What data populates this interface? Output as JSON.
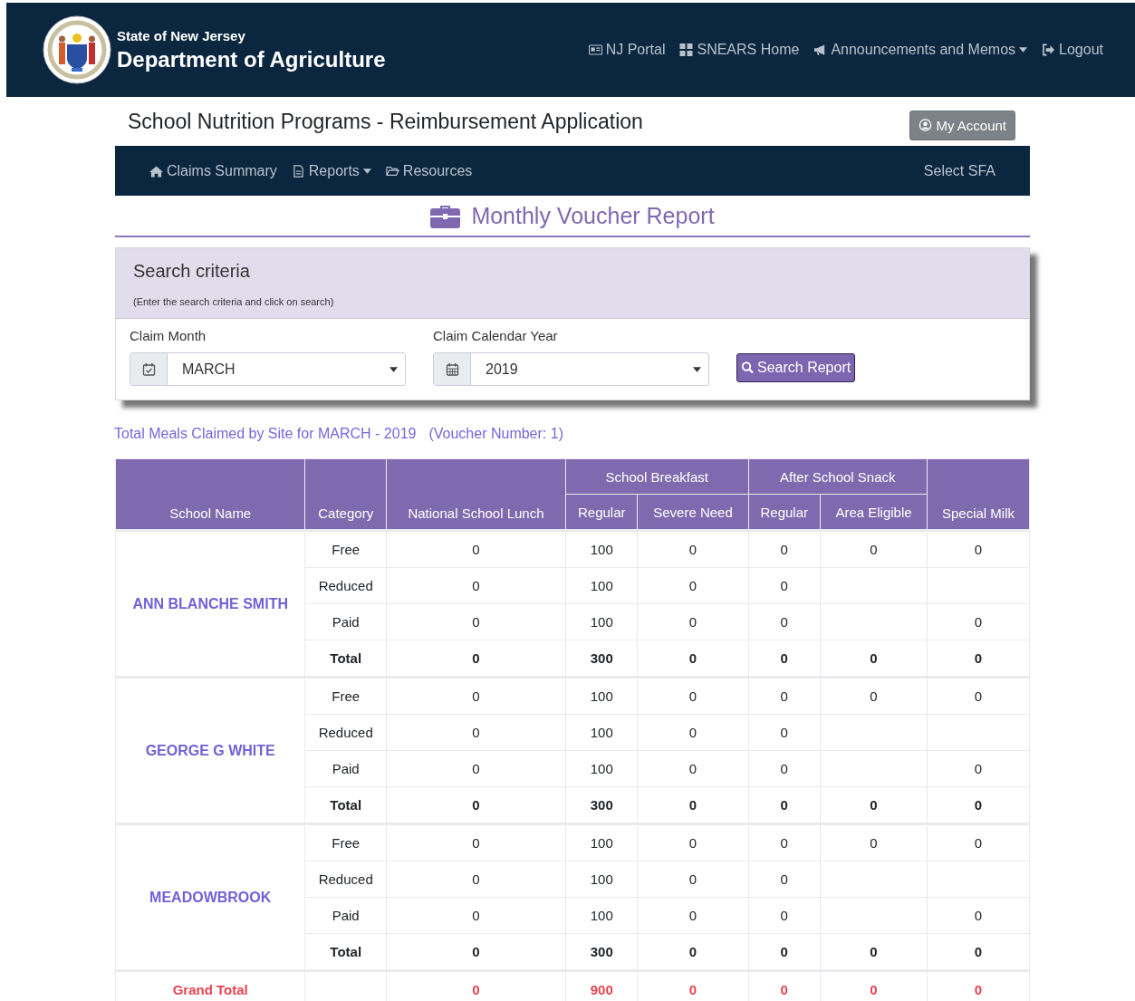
{
  "header": {
    "state": "State of New Jersey",
    "department": "Department of Agriculture",
    "links": [
      {
        "label": "NJ Portal",
        "dropdown": false
      },
      {
        "label": "SNEARS Home",
        "dropdown": false
      },
      {
        "label": "Announcements and Memos",
        "dropdown": true
      },
      {
        "label": "Logout",
        "dropdown": false
      }
    ]
  },
  "app_title": "School Nutrition Programs - Reimbursement Application",
  "account_button": "My Account",
  "nav": {
    "items": [
      {
        "label": "Claims Summary",
        "dropdown": false
      },
      {
        "label": "Reports",
        "dropdown": true
      },
      {
        "label": "Resources",
        "dropdown": false
      }
    ],
    "right_item": "Select SFA"
  },
  "page_title": "Monthly Voucher Report",
  "search": {
    "title": "Search criteria",
    "hint": "(Enter the search criteria and click on search)",
    "fields": [
      {
        "label": "Claim Month",
        "value": "MARCH"
      },
      {
        "label": "Claim Calendar Year",
        "value": "2019"
      }
    ],
    "button": "Search Report"
  },
  "summary": {
    "title": "Total Meals Claimed by Site for MARCH - 2019",
    "voucher": "(Voucher Number: 1)"
  },
  "table": {
    "columns": [
      {
        "label": "School Name"
      },
      {
        "label": "Category"
      },
      {
        "label": "National School Lunch"
      },
      {
        "group": "School Breakfast",
        "subcolumns": [
          "Regular",
          "Severe Need"
        ]
      },
      {
        "group": "After School Snack",
        "subcolumns": [
          "Regular",
          "Area Eligible"
        ]
      },
      {
        "label": "Special Milk"
      }
    ],
    "schools": [
      {
        "name": "ANN BLANCHE SMITH",
        "rows": [
          {
            "kind": "item",
            "category": "Free",
            "lunch": "0",
            "breakfast_regular": "100",
            "breakfast_severe": "0",
            "snack_regular": "0",
            "snack_area": "0",
            "milk": "0"
          },
          {
            "kind": "item",
            "category": "Reduced",
            "lunch": "0",
            "breakfast_regular": "100",
            "breakfast_severe": "0",
            "snack_regular": "0"
          },
          {
            "kind": "item",
            "category": "Paid",
            "lunch": "0",
            "breakfast_regular": "100",
            "breakfast_severe": "0",
            "snack_regular": "0",
            "milk": "0"
          },
          {
            "kind": "total",
            "category": "Total",
            "lunch": "0",
            "breakfast_regular": "300",
            "breakfast_severe": "0",
            "snack_regular": "0",
            "snack_area": "0",
            "milk": "0"
          }
        ]
      },
      {
        "name": "GEORGE G WHITE",
        "rows": [
          {
            "kind": "item",
            "category": "Free",
            "lunch": "0",
            "breakfast_regular": "100",
            "breakfast_severe": "0",
            "snack_regular": "0",
            "snack_area": "0",
            "milk": "0"
          },
          {
            "kind": "item",
            "category": "Reduced",
            "lunch": "0",
            "breakfast_regular": "100",
            "breakfast_severe": "0",
            "snack_regular": "0"
          },
          {
            "kind": "item",
            "category": "Paid",
            "lunch": "0",
            "breakfast_regular": "100",
            "breakfast_severe": "0",
            "snack_regular": "0",
            "milk": "0"
          },
          {
            "kind": "total",
            "category": "Total",
            "lunch": "0",
            "breakfast_regular": "300",
            "breakfast_severe": "0",
            "snack_regular": "0",
            "snack_area": "0",
            "milk": "0"
          }
        ]
      },
      {
        "name": "MEADOWBROOK",
        "rows": [
          {
            "kind": "item",
            "category": "Free",
            "lunch": "0",
            "breakfast_regular": "100",
            "breakfast_severe": "0",
            "snack_regular": "0",
            "snack_area": "0",
            "milk": "0"
          },
          {
            "kind": "item",
            "category": "Reduced",
            "lunch": "0",
            "breakfast_regular": "100",
            "breakfast_severe": "0",
            "snack_regular": "0"
          },
          {
            "kind": "item",
            "category": "Paid",
            "lunch": "0",
            "breakfast_regular": "100",
            "breakfast_severe": "0",
            "snack_regular": "0",
            "milk": "0"
          },
          {
            "kind": "total",
            "category": "Total",
            "lunch": "0",
            "breakfast_regular": "300",
            "breakfast_severe": "0",
            "snack_regular": "0",
            "snack_area": "0",
            "milk": "0"
          }
        ]
      }
    ],
    "grand_total": {
      "label": "Grand Total",
      "lunch": "0",
      "breakfast_regular": "900",
      "breakfast_severe": "0",
      "snack_regular": "0",
      "snack_area": "0",
      "milk": "0"
    }
  }
}
